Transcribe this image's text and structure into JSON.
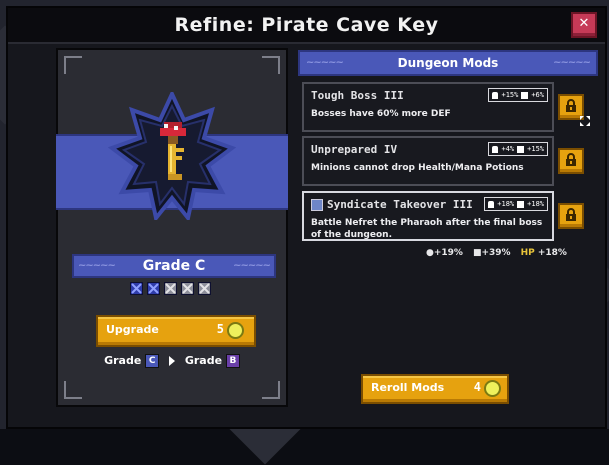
{
  "window": {
    "title": "Refine: Pirate Cave Key",
    "close_icon": "x-icon"
  },
  "item": {
    "name": "Pirate Cave Key",
    "icon": "key-icon",
    "grade_label": "Grade C",
    "grade_pips_total": 5,
    "grade_pips_filled": 2
  },
  "upgrade": {
    "label": "Upgrade",
    "cost": "5",
    "from_prefix": "Grade",
    "from_grade": "C",
    "to_prefix": "Grade",
    "to_grade": "B"
  },
  "mods": {
    "header": "Dungeon Mods",
    "items": [
      {
        "name": "Tough Boss III",
        "desc": "Bosses have 60% more DEF",
        "tag_a": "+15%",
        "tag_b": "+6%",
        "selected": false
      },
      {
        "name": "Unprepared IV",
        "desc": "Minions cannot drop Health/Mana Potions",
        "tag_a": "+4%",
        "tag_b": "+15%",
        "selected": false
      },
      {
        "name": "Syndicate Takeover III",
        "desc": "Battle Nefret the Pharaoh after the final boss of the dungeon.",
        "tag_a": "+18%",
        "tag_b": "+18%",
        "selected": true
      }
    ],
    "totals": {
      "a": "+19%",
      "b": "+39%",
      "hp_label": "HP",
      "c": "+18%"
    }
  },
  "reroll": {
    "label": "Reroll Mods",
    "cost": "4"
  },
  "colors": {
    "accent_blue": "#4a58b8",
    "gold": "#e6a20f",
    "close_red": "#c63a57",
    "coin": "#eef05c"
  }
}
